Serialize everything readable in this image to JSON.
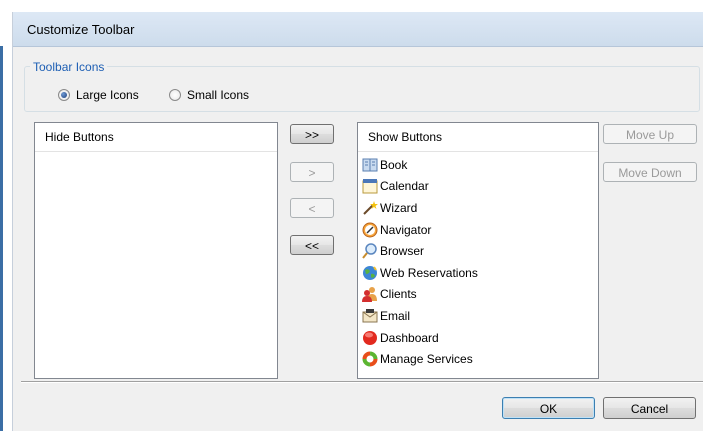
{
  "window": {
    "title": "Customize Toolbar"
  },
  "toolbar_icons": {
    "legend": "Toolbar Icons",
    "options": [
      {
        "label": "Large Icons",
        "checked": true
      },
      {
        "label": "Small Icons",
        "checked": false
      }
    ]
  },
  "hide_list": {
    "header": "Hide Buttons",
    "items": []
  },
  "show_list": {
    "header": "Show Buttons",
    "items": [
      {
        "label": "Book",
        "icon": "book-icon"
      },
      {
        "label": "Calendar",
        "icon": "calendar-icon"
      },
      {
        "label": "Wizard",
        "icon": "wizard-wand-icon"
      },
      {
        "label": "Navigator",
        "icon": "compass-icon"
      },
      {
        "label": "Browser",
        "icon": "magnifier-icon"
      },
      {
        "label": "Web Reservations",
        "icon": "globe-icon"
      },
      {
        "label": "Clients",
        "icon": "people-icon"
      },
      {
        "label": "Email",
        "icon": "envelope-icon"
      },
      {
        "label": "Dashboard",
        "icon": "red-circle-icon"
      },
      {
        "label": "Manage Services",
        "icon": "colorful-ring-icon"
      }
    ]
  },
  "transfer_buttons": {
    "add_all": ">>",
    "add": ">",
    "remove": "<",
    "remove_all": "<<"
  },
  "order_buttons": {
    "move_up": "Move Up",
    "move_down": "Move Down"
  },
  "dialog_buttons": {
    "ok": "OK",
    "cancel": "Cancel"
  },
  "colors": {
    "accent": "#1e5fb4",
    "window_bg": "#f0f0f0",
    "title_bar": "#dde8f5"
  }
}
